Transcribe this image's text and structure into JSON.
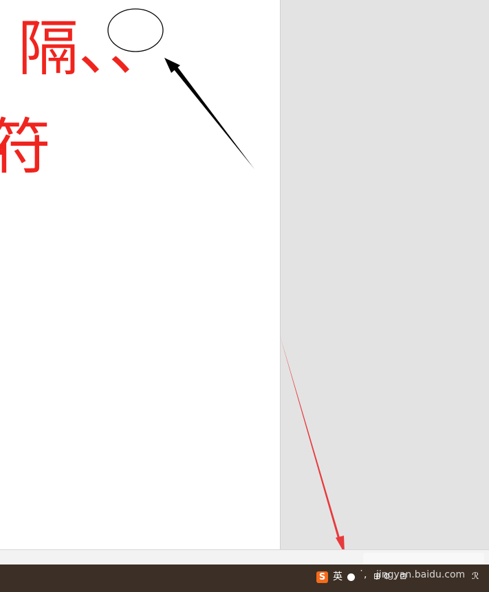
{
  "document": {
    "line1": "隔、、",
    "line2": "符"
  },
  "ime_tray": {
    "logo": "S",
    "lang": "英",
    "punct": "˙,",
    "glyphs": "⊞ ⚙ ⸝ ⊡",
    "watermark": "jingyan.baidu.com",
    "user": "ℛ"
  },
  "colors": {
    "doc_text": "#f0241e",
    "annotation_black": "#000000",
    "annotation_red": "#e8393c",
    "taskbar": "#3b2f26"
  },
  "icons": [
    "moon-icon",
    "user-icon"
  ]
}
